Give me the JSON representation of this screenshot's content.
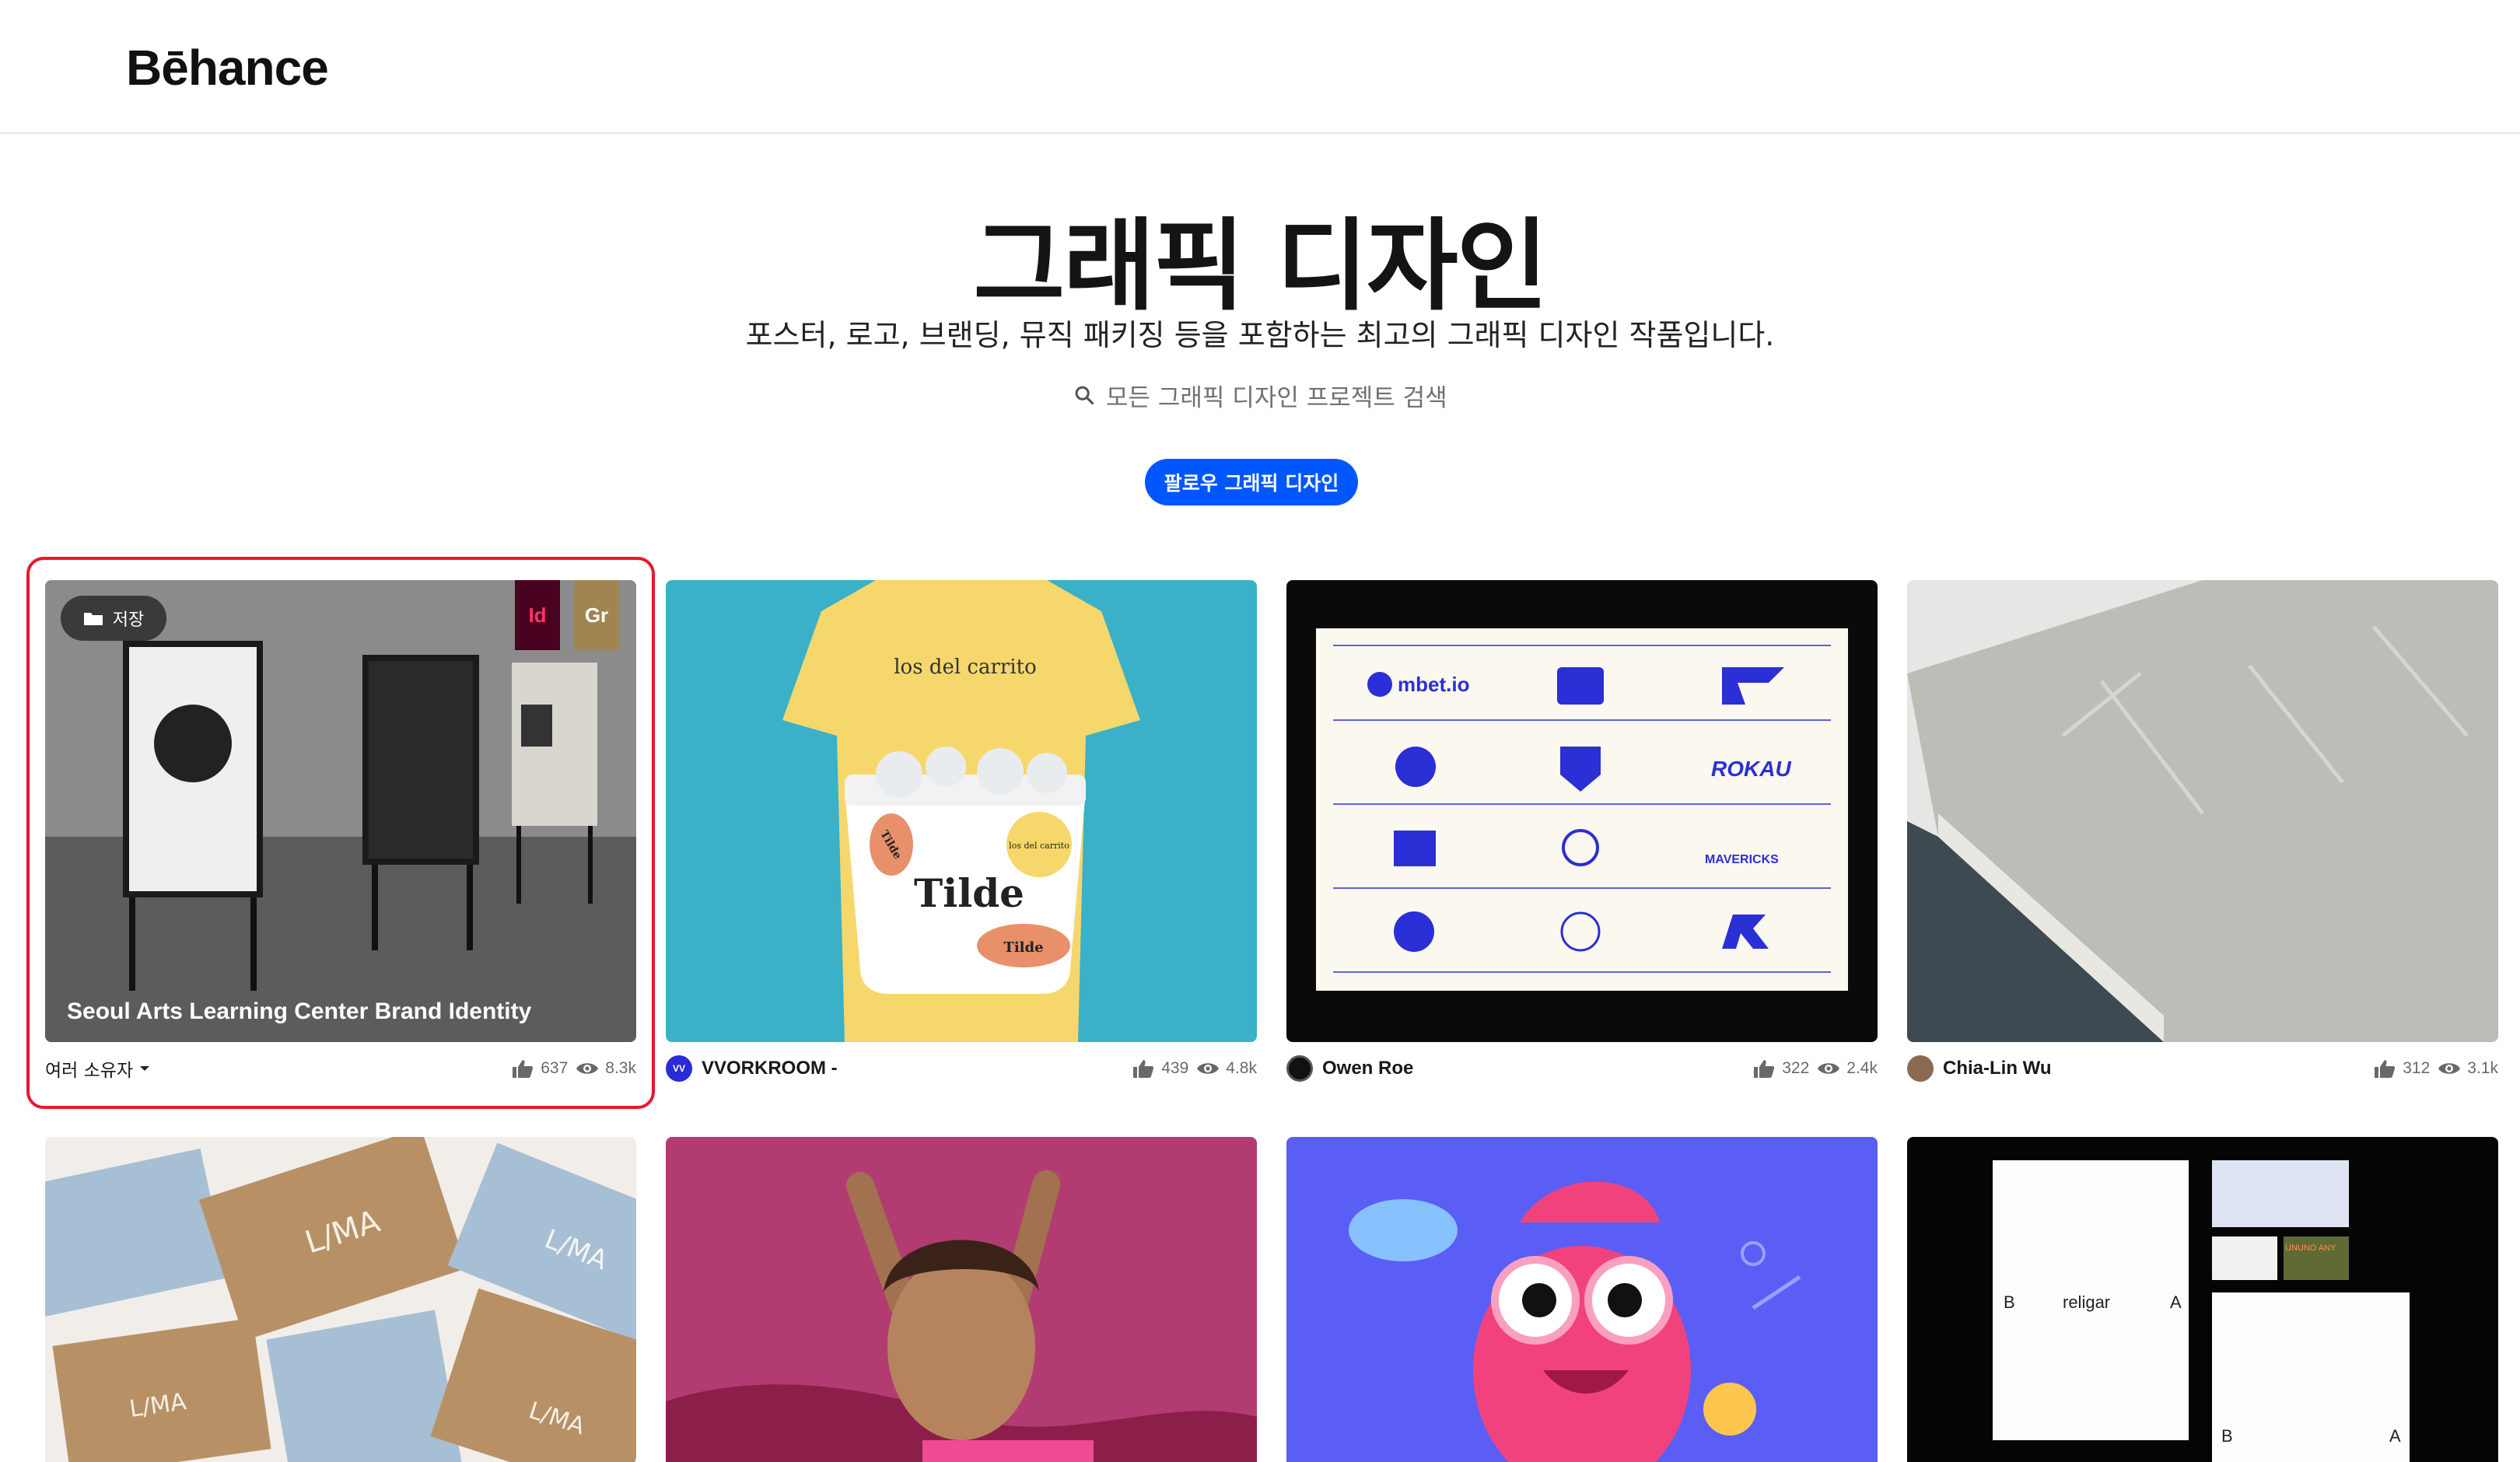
{
  "brand": {
    "logo_text": "Bēhance"
  },
  "hero": {
    "title": "그래픽 디자인",
    "subtitle": "포스터, 로고, 브랜딩, 뮤직 패키징 등을 포함하는 최고의 그래픽 디자인 작품입니다.",
    "search_text": "모든 그래픽 디자인 프로젝트 검색",
    "follow_label": "팔로우 그래픽 디자인"
  },
  "projects": [
    {
      "title": "Seoul Arts Learning Center Brand Identity",
      "owner": "여러 소유자",
      "likes": "637",
      "views": "8.3k",
      "save_label": "저장",
      "badges": [
        "Id",
        "Gr"
      ]
    },
    {
      "thumb_texts": [
        "los del carrito",
        "Tilde",
        "Tilde",
        "Tilde",
        "los del carrito"
      ],
      "owner": "VVORKROOM -",
      "avatar_text": "VV",
      "likes": "439",
      "views": "4.8k"
    },
    {
      "thumb_texts": [
        "mbet.io",
        "ROKAU",
        "MAVERICKS"
      ],
      "owner": "Owen Roe",
      "likes": "322",
      "views": "2.4k"
    },
    {
      "owner": "Chia-Lin Wu",
      "likes": "312",
      "views": "3.1k"
    },
    {
      "thumb_texts": [
        "L/MA",
        "L/MA",
        "L/MA",
        "L/MA"
      ]
    },
    {},
    {},
    {
      "thumb_texts": [
        "B",
        "religar",
        "A",
        "B",
        "A",
        "UNUNO ANY"
      ]
    }
  ],
  "colors": {
    "accent": "#0057ff",
    "highlight": "#e8172c"
  }
}
